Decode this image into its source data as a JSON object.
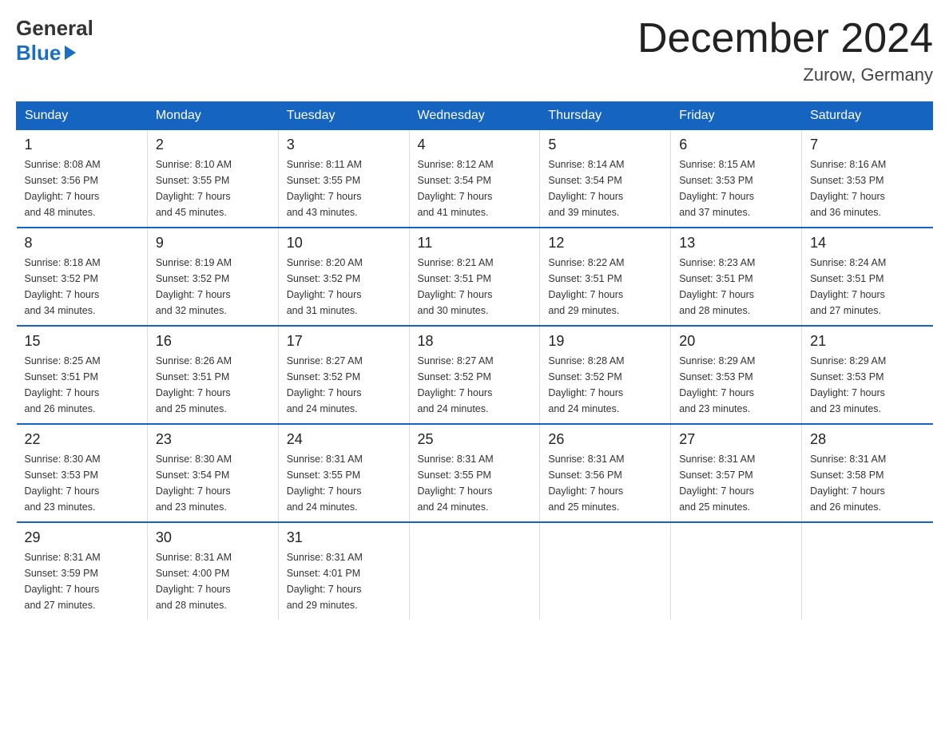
{
  "header": {
    "logo_line1": "General",
    "logo_line2": "Blue",
    "title": "December 2024",
    "location": "Zurow, Germany"
  },
  "days_of_week": [
    "Sunday",
    "Monday",
    "Tuesday",
    "Wednesday",
    "Thursday",
    "Friday",
    "Saturday"
  ],
  "weeks": [
    [
      {
        "day": "1",
        "info": "Sunrise: 8:08 AM\nSunset: 3:56 PM\nDaylight: 7 hours\nand 48 minutes."
      },
      {
        "day": "2",
        "info": "Sunrise: 8:10 AM\nSunset: 3:55 PM\nDaylight: 7 hours\nand 45 minutes."
      },
      {
        "day": "3",
        "info": "Sunrise: 8:11 AM\nSunset: 3:55 PM\nDaylight: 7 hours\nand 43 minutes."
      },
      {
        "day": "4",
        "info": "Sunrise: 8:12 AM\nSunset: 3:54 PM\nDaylight: 7 hours\nand 41 minutes."
      },
      {
        "day": "5",
        "info": "Sunrise: 8:14 AM\nSunset: 3:54 PM\nDaylight: 7 hours\nand 39 minutes."
      },
      {
        "day": "6",
        "info": "Sunrise: 8:15 AM\nSunset: 3:53 PM\nDaylight: 7 hours\nand 37 minutes."
      },
      {
        "day": "7",
        "info": "Sunrise: 8:16 AM\nSunset: 3:53 PM\nDaylight: 7 hours\nand 36 minutes."
      }
    ],
    [
      {
        "day": "8",
        "info": "Sunrise: 8:18 AM\nSunset: 3:52 PM\nDaylight: 7 hours\nand 34 minutes."
      },
      {
        "day": "9",
        "info": "Sunrise: 8:19 AM\nSunset: 3:52 PM\nDaylight: 7 hours\nand 32 minutes."
      },
      {
        "day": "10",
        "info": "Sunrise: 8:20 AM\nSunset: 3:52 PM\nDaylight: 7 hours\nand 31 minutes."
      },
      {
        "day": "11",
        "info": "Sunrise: 8:21 AM\nSunset: 3:51 PM\nDaylight: 7 hours\nand 30 minutes."
      },
      {
        "day": "12",
        "info": "Sunrise: 8:22 AM\nSunset: 3:51 PM\nDaylight: 7 hours\nand 29 minutes."
      },
      {
        "day": "13",
        "info": "Sunrise: 8:23 AM\nSunset: 3:51 PM\nDaylight: 7 hours\nand 28 minutes."
      },
      {
        "day": "14",
        "info": "Sunrise: 8:24 AM\nSunset: 3:51 PM\nDaylight: 7 hours\nand 27 minutes."
      }
    ],
    [
      {
        "day": "15",
        "info": "Sunrise: 8:25 AM\nSunset: 3:51 PM\nDaylight: 7 hours\nand 26 minutes."
      },
      {
        "day": "16",
        "info": "Sunrise: 8:26 AM\nSunset: 3:51 PM\nDaylight: 7 hours\nand 25 minutes."
      },
      {
        "day": "17",
        "info": "Sunrise: 8:27 AM\nSunset: 3:52 PM\nDaylight: 7 hours\nand 24 minutes."
      },
      {
        "day": "18",
        "info": "Sunrise: 8:27 AM\nSunset: 3:52 PM\nDaylight: 7 hours\nand 24 minutes."
      },
      {
        "day": "19",
        "info": "Sunrise: 8:28 AM\nSunset: 3:52 PM\nDaylight: 7 hours\nand 24 minutes."
      },
      {
        "day": "20",
        "info": "Sunrise: 8:29 AM\nSunset: 3:53 PM\nDaylight: 7 hours\nand 23 minutes."
      },
      {
        "day": "21",
        "info": "Sunrise: 8:29 AM\nSunset: 3:53 PM\nDaylight: 7 hours\nand 23 minutes."
      }
    ],
    [
      {
        "day": "22",
        "info": "Sunrise: 8:30 AM\nSunset: 3:53 PM\nDaylight: 7 hours\nand 23 minutes."
      },
      {
        "day": "23",
        "info": "Sunrise: 8:30 AM\nSunset: 3:54 PM\nDaylight: 7 hours\nand 23 minutes."
      },
      {
        "day": "24",
        "info": "Sunrise: 8:31 AM\nSunset: 3:55 PM\nDaylight: 7 hours\nand 24 minutes."
      },
      {
        "day": "25",
        "info": "Sunrise: 8:31 AM\nSunset: 3:55 PM\nDaylight: 7 hours\nand 24 minutes."
      },
      {
        "day": "26",
        "info": "Sunrise: 8:31 AM\nSunset: 3:56 PM\nDaylight: 7 hours\nand 25 minutes."
      },
      {
        "day": "27",
        "info": "Sunrise: 8:31 AM\nSunset: 3:57 PM\nDaylight: 7 hours\nand 25 minutes."
      },
      {
        "day": "28",
        "info": "Sunrise: 8:31 AM\nSunset: 3:58 PM\nDaylight: 7 hours\nand 26 minutes."
      }
    ],
    [
      {
        "day": "29",
        "info": "Sunrise: 8:31 AM\nSunset: 3:59 PM\nDaylight: 7 hours\nand 27 minutes."
      },
      {
        "day": "30",
        "info": "Sunrise: 8:31 AM\nSunset: 4:00 PM\nDaylight: 7 hours\nand 28 minutes."
      },
      {
        "day": "31",
        "info": "Sunrise: 8:31 AM\nSunset: 4:01 PM\nDaylight: 7 hours\nand 29 minutes."
      },
      {
        "day": "",
        "info": ""
      },
      {
        "day": "",
        "info": ""
      },
      {
        "day": "",
        "info": ""
      },
      {
        "day": "",
        "info": ""
      }
    ]
  ]
}
